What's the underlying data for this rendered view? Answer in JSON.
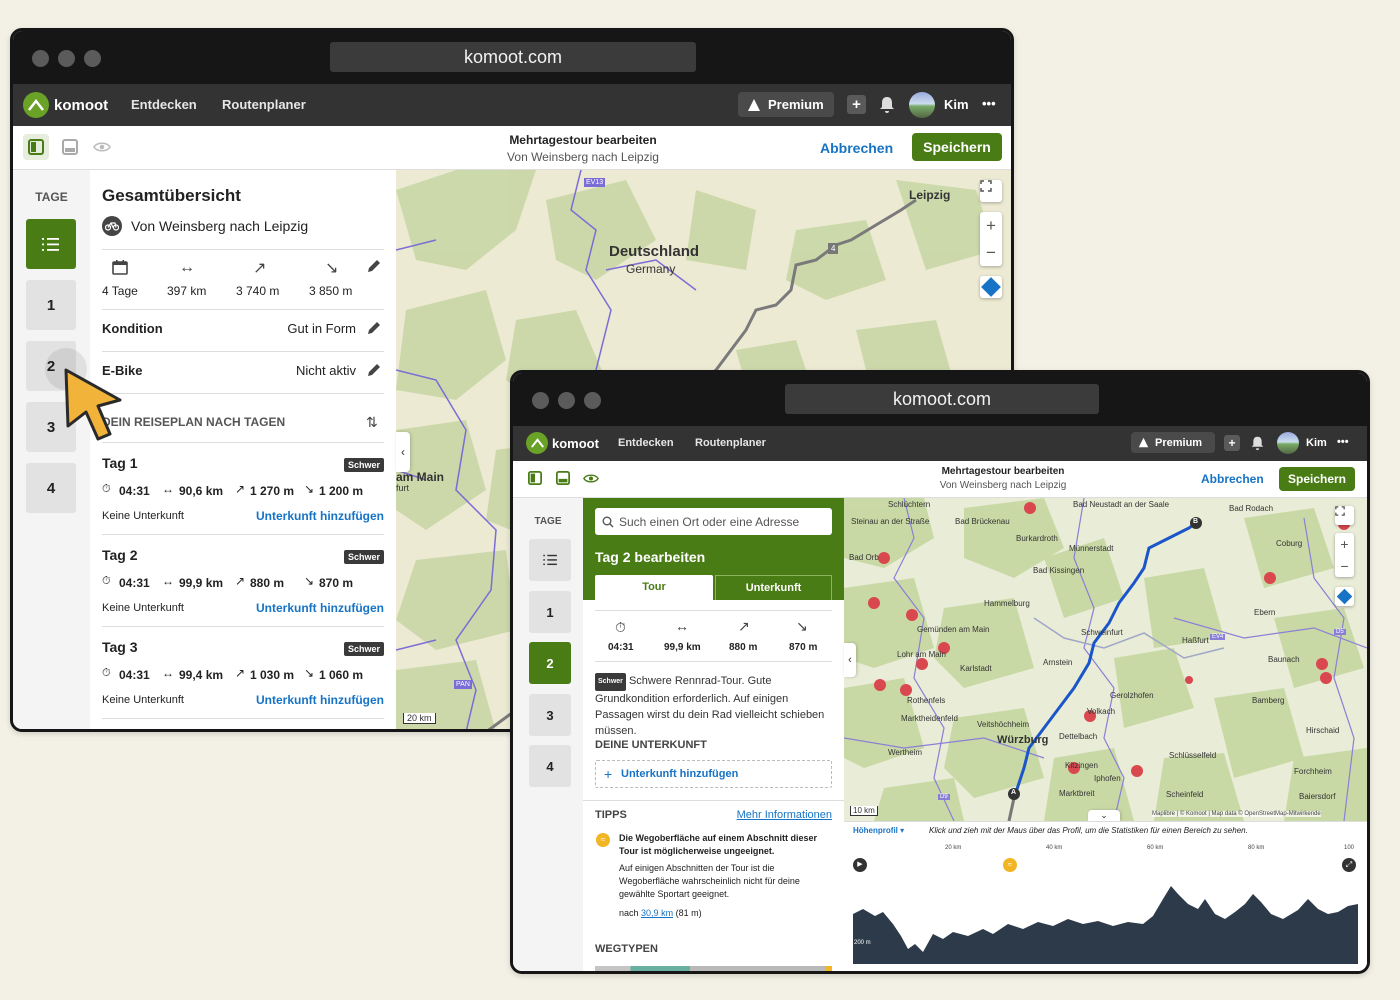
{
  "browser": {
    "url": "komoot.com"
  },
  "nav": {
    "brand": "komoot",
    "links": [
      "Entdecken",
      "Routenplaner"
    ],
    "premium": "Premium",
    "plus": "+",
    "user": "Kim",
    "more": "•••"
  },
  "toolbar": {
    "title": "Mehrtagestour bearbeiten",
    "subtitle": "Von Weinsberg nach Leipzig",
    "cancel": "Abbrechen",
    "save": "Speichern"
  },
  "days": {
    "label": "TAGE",
    "items": [
      "1",
      "2",
      "3",
      "4"
    ]
  },
  "overview": {
    "title": "Gesamtübersicht",
    "route": "Von Weinsberg nach Leipzig",
    "stats": {
      "days": "4 Tage",
      "distance": "397 km",
      "up": "3 740 m",
      "down": "3 850 m"
    },
    "kondition_label": "Kondition",
    "kondition_value": "Gut in Form",
    "ebike_label": "E-Bike",
    "ebike_value": "Nicht aktiv",
    "plan_heading": "DEIN REISEPLAN NACH TAGEN",
    "day_entries": [
      {
        "title": "Tag 1",
        "badge": "Schwer",
        "time": "04:31",
        "dist": "90,6 km",
        "up": "1 270 m",
        "down": "1 200 m",
        "lodging": "Keine Unterkunft",
        "add": "Unterkunft hinzufügen"
      },
      {
        "title": "Tag 2",
        "badge": "Schwer",
        "time": "04:31",
        "dist": "99,9 km",
        "up": "880 m",
        "down": "870 m",
        "lodging": "Keine Unterkunft",
        "add": "Unterkunft hinzufügen"
      },
      {
        "title": "Tag 3",
        "badge": "Schwer",
        "time": "04:31",
        "dist": "99,4 km",
        "up": "1 030 m",
        "down": "1 060 m",
        "lodging": "Keine Unterkunft",
        "add": "Unterkunft hinzufügen"
      }
    ]
  },
  "map1": {
    "country": "Deutschland",
    "country_en": "Germany",
    "city": "Leipzig",
    "city2": "am Main",
    "city2b": "furt",
    "road_ev13": "EV13",
    "road_4": "4",
    "road_pan": "PAN",
    "scale": "20 km"
  },
  "edit": {
    "search_placeholder": "Such einen Ort oder eine Adresse",
    "title": "Tag 2 bearbeiten",
    "tab_tour": "Tour",
    "tab_lodging": "Unterkunft",
    "stats": {
      "time": "04:31",
      "dist": "99,9 km",
      "up": "880 m",
      "down": "870 m"
    },
    "badge": "Schwer",
    "desc": "Schwere Rennrad-Tour. Gute Grundkondition erforderlich. Auf einigen Passagen wirst du dein Rad vielleicht schieben müssen.",
    "lodging_heading": "DEINE UNTERKUNFT",
    "lodging_add": "Unterkunft hinzufügen",
    "tips_heading": "TIPPS",
    "more_info": "Mehr Informationen",
    "tip_title": "Die Wegoberfläche auf einem Abschnitt dieser Tour ist möglicherweise ungeeignet.",
    "tip_body": "Auf einigen Abschnitten der Tour ist die Wegoberfläche wahrscheinlich nicht für deine gewählte Sportart geeignet.",
    "tip_after": "nach",
    "tip_link": "30,9 km",
    "tip_alt": "(81 m)",
    "waytypes": "WEGTYPEN"
  },
  "map2": {
    "places": [
      "Schlüchtern",
      "Steinau an der Straße",
      "Bad Brückenau",
      "Bad Neustadt an der Saale",
      "Bad Rodach",
      "Neusta",
      "Bad Orb",
      "Burkardroth",
      "Münnerstadt",
      "Coburg",
      "Bad Kissingen",
      "Ebersdorf b.Co",
      "Lichtenf",
      "Hammelburg",
      "Ebern",
      "Bad Staffelstein",
      "Gemünden am Main",
      "Schweinfurt",
      "Haßfurt",
      "Lohr am Main",
      "Karlstadt",
      "Arnstein",
      "Baunach",
      "Scheßlitz",
      "Gerolzhofen",
      "Hallstadt",
      "Rothenfels",
      "Bamberg",
      "Marktheidenfeld",
      "Veitshöchheim",
      "Volkach",
      "Würzburg",
      "Dettelbach",
      "Hirschaid",
      "Wertheim",
      "Kitzingen",
      "Schlüsselfeld",
      "Höchstadt an der Aisch",
      "Forchheim",
      "Iphofen",
      "Ebermann",
      "Marktbreit",
      "Scheinfeld",
      "Baiersdorf",
      "Tauberbischofsheim",
      "Ochsenfurt"
    ],
    "roads": [
      "D5",
      "EV4",
      "D9"
    ],
    "scale": "10 km",
    "attribution": "Maplibre | © Komoot | Map data © OpenStreetMap-Mitwirkende",
    "start": "A",
    "end": "B"
  },
  "profile": {
    "label": "Höhenprofil",
    "hint": "Klick und zieh mit der Maus über das Profil, um die Statistiken für einen Bereich zu sehen.",
    "ticks": [
      "20 km",
      "40 km",
      "60 km",
      "80 km",
      "100"
    ],
    "y_labels": [
      "400 m",
      "200 m"
    ]
  },
  "colors": {
    "green": "#4a7c16",
    "link": "#1673c5",
    "route_blue": "#1a56c9",
    "nav": "#333333"
  }
}
